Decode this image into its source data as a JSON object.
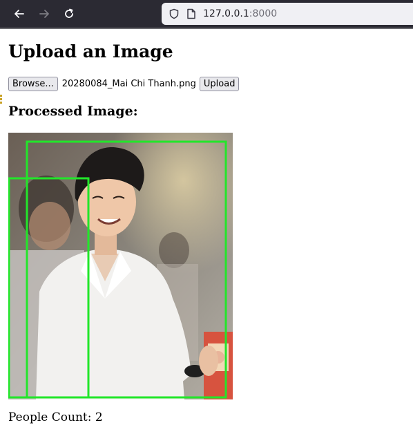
{
  "browser": {
    "url_host": "127.0.0.1",
    "url_port": ":8000"
  },
  "page": {
    "title": "Upload an Image",
    "browse_label": "Browse...",
    "filename": "20280084_Mai Chi Thanh.png",
    "upload_label": "Upload",
    "processed_heading": "Processed Image:",
    "count_label": "People Count: 2"
  },
  "detections": {
    "box_color": "#22e62a",
    "count": 2
  }
}
